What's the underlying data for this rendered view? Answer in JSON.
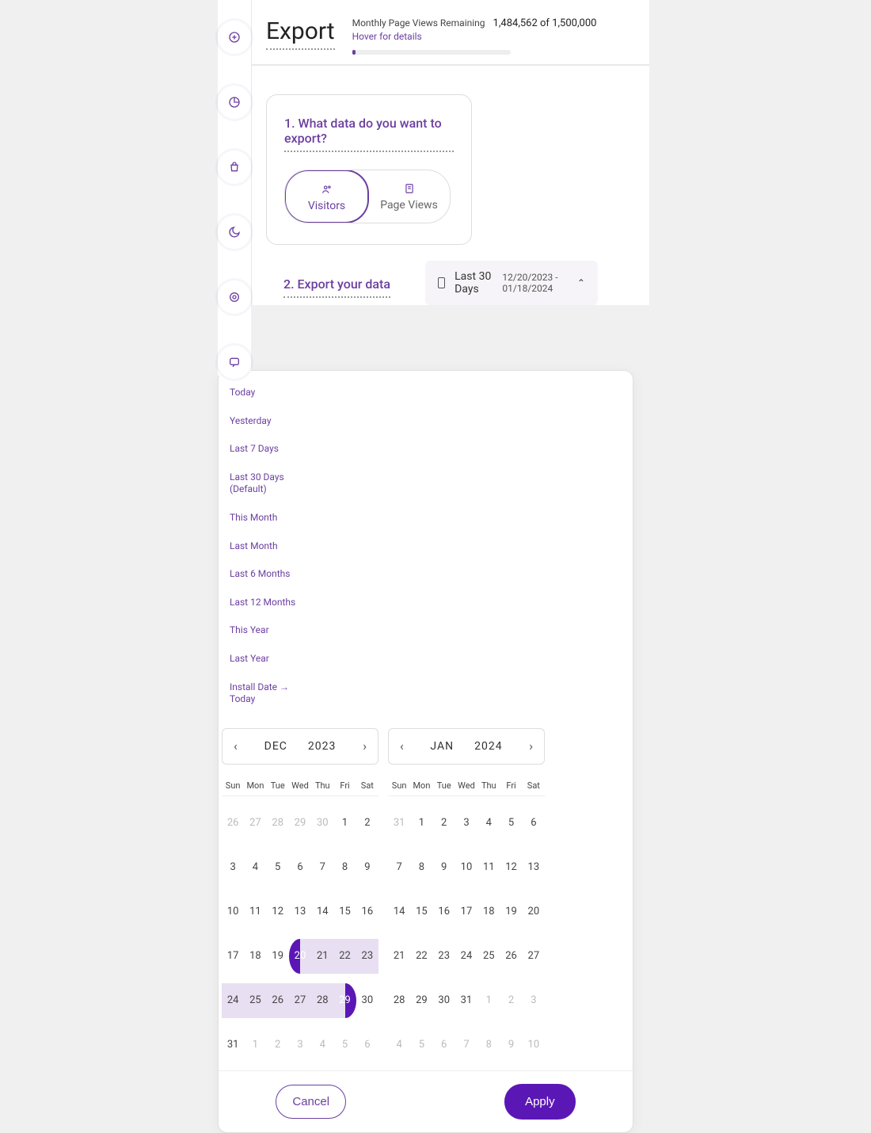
{
  "header": {
    "title": "Export",
    "quota_label": "Monthly Page Views Remaining",
    "quota_used": "1,484,562",
    "quota_sep": " of ",
    "quota_total": "1,500,000",
    "hover_hint": "Hover for details"
  },
  "step1": {
    "heading": "1. What data do you want to export?",
    "options": {
      "visitors": "Visitors",
      "page_views": "Page Views"
    }
  },
  "step2": {
    "heading": "2. Export your data",
    "trigger_label": "Last 30 Days",
    "trigger_range": "12/20/2023 - 01/18/2024"
  },
  "picker": {
    "presets": [
      "Today",
      "Yesterday",
      "Last 7 Days",
      "Last 30 Days  (Default)",
      "This Month",
      "Last Month",
      "Last 6 Months",
      "Last 12 Months",
      "This Year",
      "Last Year",
      "Install Date → Today"
    ],
    "dow": [
      "Sun",
      "Mon",
      "Tue",
      "Wed",
      "Thu",
      "Fri",
      "Sat"
    ],
    "months": [
      {
        "label_month": "DEC",
        "label_year": "2023",
        "range_start": 20,
        "range_end": 29,
        "weeks": [
          [
            [
              26,
              true
            ],
            [
              27,
              true
            ],
            [
              28,
              true
            ],
            [
              29,
              true
            ],
            [
              30,
              true
            ],
            [
              1,
              false
            ],
            [
              2,
              false
            ]
          ],
          [
            [
              3,
              false
            ],
            [
              4,
              false
            ],
            [
              5,
              false
            ],
            [
              6,
              false
            ],
            [
              7,
              false
            ],
            [
              8,
              false
            ],
            [
              9,
              false
            ]
          ],
          [
            [
              10,
              false
            ],
            [
              11,
              false
            ],
            [
              12,
              false
            ],
            [
              13,
              false
            ],
            [
              14,
              false
            ],
            [
              15,
              false
            ],
            [
              16,
              false
            ]
          ],
          [
            [
              17,
              false
            ],
            [
              18,
              false
            ],
            [
              19,
              false
            ],
            [
              20,
              false
            ],
            [
              21,
              false
            ],
            [
              22,
              false
            ],
            [
              23,
              false
            ]
          ],
          [
            [
              24,
              false
            ],
            [
              25,
              false
            ],
            [
              26,
              false
            ],
            [
              27,
              false
            ],
            [
              28,
              false
            ],
            [
              29,
              false
            ],
            [
              30,
              false
            ]
          ],
          [
            [
              31,
              false
            ],
            [
              1,
              true
            ],
            [
              2,
              true
            ],
            [
              3,
              true
            ],
            [
              4,
              true
            ],
            [
              5,
              true
            ],
            [
              6,
              true
            ]
          ]
        ]
      },
      {
        "label_month": "JAN",
        "label_year": "2024",
        "range_start": null,
        "range_end": null,
        "weeks": [
          [
            [
              31,
              true
            ],
            [
              1,
              false
            ],
            [
              2,
              false
            ],
            [
              3,
              false
            ],
            [
              4,
              false
            ],
            [
              5,
              false
            ],
            [
              6,
              false
            ]
          ],
          [
            [
              7,
              false
            ],
            [
              8,
              false
            ],
            [
              9,
              false
            ],
            [
              10,
              false
            ],
            [
              11,
              false
            ],
            [
              12,
              false
            ],
            [
              13,
              false
            ]
          ],
          [
            [
              14,
              false
            ],
            [
              15,
              false
            ],
            [
              16,
              false
            ],
            [
              17,
              false
            ],
            [
              18,
              false
            ],
            [
              19,
              false
            ],
            [
              20,
              false
            ]
          ],
          [
            [
              21,
              false
            ],
            [
              22,
              false
            ],
            [
              23,
              false
            ],
            [
              24,
              false
            ],
            [
              25,
              false
            ],
            [
              26,
              false
            ],
            [
              27,
              false
            ]
          ],
          [
            [
              28,
              false
            ],
            [
              29,
              false
            ],
            [
              30,
              false
            ],
            [
              31,
              false
            ],
            [
              1,
              true
            ],
            [
              2,
              true
            ],
            [
              3,
              true
            ]
          ],
          [
            [
              4,
              true
            ],
            [
              5,
              true
            ],
            [
              6,
              true
            ],
            [
              7,
              true
            ],
            [
              8,
              true
            ],
            [
              9,
              true
            ],
            [
              10,
              true
            ]
          ]
        ]
      }
    ],
    "buttons": {
      "cancel": "Cancel",
      "apply": "Apply"
    }
  },
  "rail_icons": [
    "plus",
    "pie",
    "bag",
    "moon",
    "target",
    "chat"
  ]
}
